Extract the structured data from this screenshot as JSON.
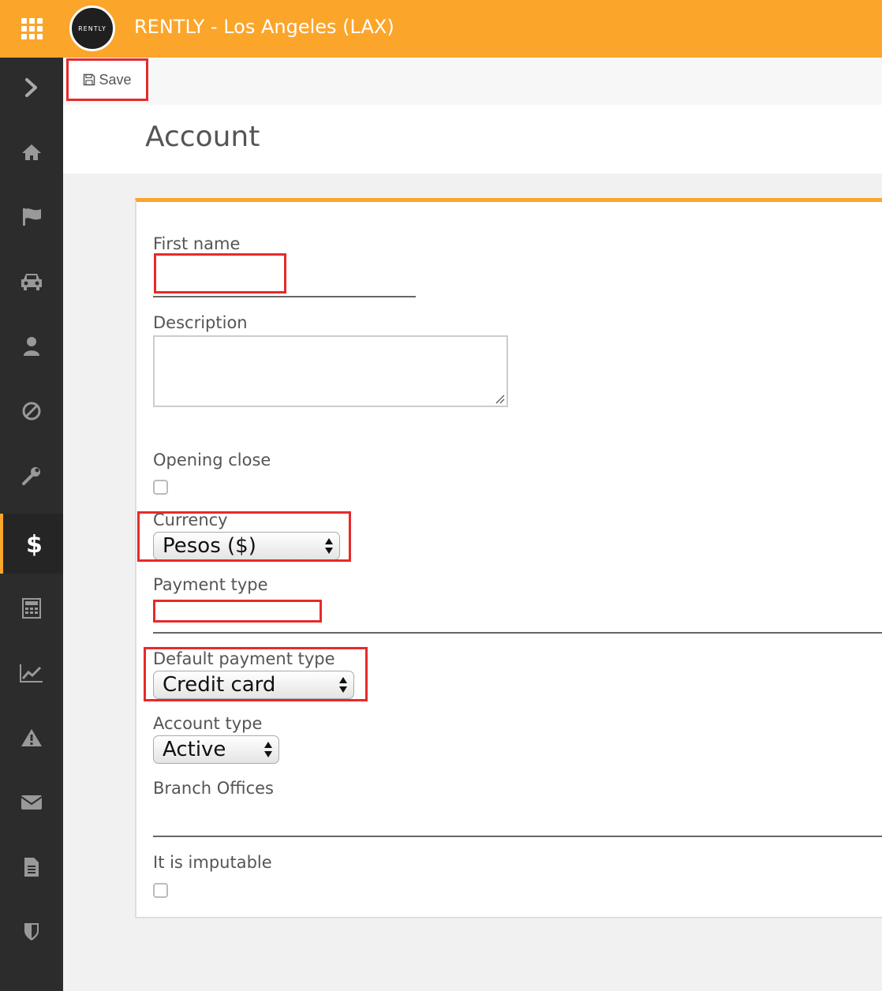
{
  "app": {
    "title": "RENTLY - Los Angeles (LAX)",
    "logo_text": "RENTLY"
  },
  "colors": {
    "accent": "#fba52b",
    "sidebar": "#2c2c2c",
    "highlight": "#e62a2a"
  },
  "sidebar": {
    "items": [
      {
        "icon": "chevron-right-icon"
      },
      {
        "icon": "home-icon"
      },
      {
        "icon": "flag-icon"
      },
      {
        "icon": "car-icon"
      },
      {
        "icon": "user-icon"
      },
      {
        "icon": "ban-icon"
      },
      {
        "icon": "wrench-icon"
      },
      {
        "icon": "dollar-icon",
        "active": true
      },
      {
        "icon": "calculator-icon"
      },
      {
        "icon": "chart-line-icon"
      },
      {
        "icon": "warning-icon"
      },
      {
        "icon": "envelope-icon"
      },
      {
        "icon": "document-icon"
      },
      {
        "icon": "shield-icon"
      }
    ]
  },
  "toolbar": {
    "save_label": "Save"
  },
  "page": {
    "title": "Account"
  },
  "form": {
    "first_name": {
      "label": "First name",
      "value": ""
    },
    "description": {
      "label": "Description",
      "value": ""
    },
    "opening_close": {
      "label": "Opening close",
      "checked": false
    },
    "currency": {
      "label": "Currency",
      "value": "Pesos ($)"
    },
    "payment_type": {
      "label": "Payment type"
    },
    "default_payment_type": {
      "label": "Default payment type",
      "value": "Credit card"
    },
    "account_type": {
      "label": "Account type",
      "value": "Active"
    },
    "branch_offices": {
      "label": "Branch Offices"
    },
    "imputable": {
      "label": "It is imputable",
      "checked": false
    }
  }
}
